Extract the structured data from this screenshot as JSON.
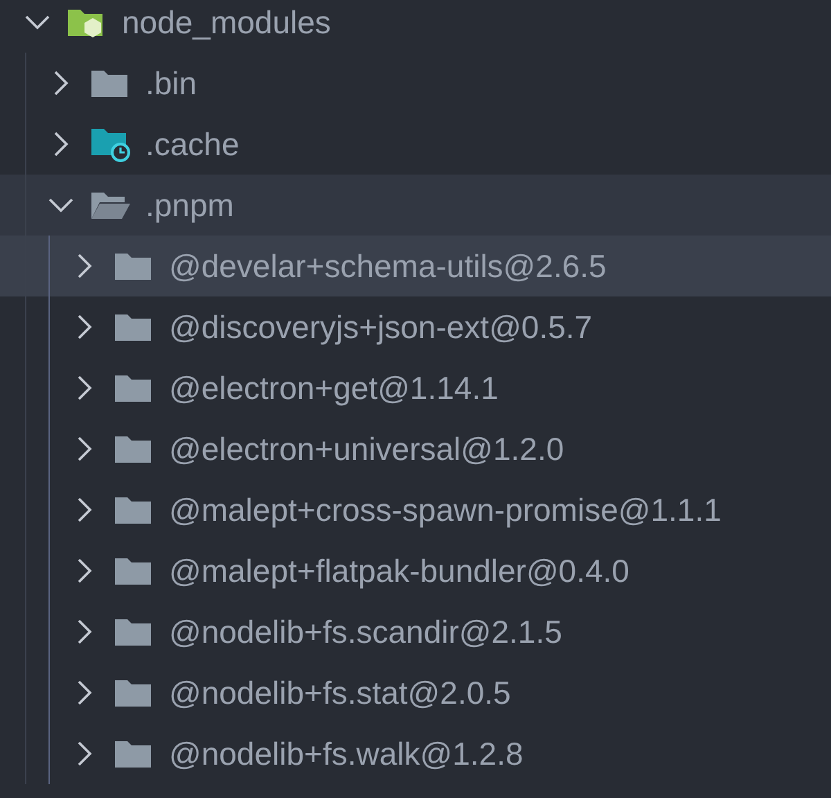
{
  "tree": [
    {
      "name": "node_modules",
      "kind": "node",
      "expanded": true,
      "selected": false,
      "hovered": false,
      "children": [
        {
          "name": ".bin",
          "kind": "folder",
          "expanded": false,
          "selected": false,
          "hovered": false
        },
        {
          "name": ".cache",
          "kind": "cache",
          "expanded": false,
          "selected": false,
          "hovered": false
        },
        {
          "name": ".pnpm",
          "kind": "folder",
          "expanded": true,
          "selected": false,
          "hovered": true,
          "children": [
            {
              "name": "@develar+schema-utils@2.6.5",
              "kind": "folder",
              "expanded": false,
              "selected": true,
              "hovered": false
            },
            {
              "name": "@discoveryjs+json-ext@0.5.7",
              "kind": "folder",
              "expanded": false,
              "selected": false,
              "hovered": false
            },
            {
              "name": "@electron+get@1.14.1",
              "kind": "folder",
              "expanded": false,
              "selected": false,
              "hovered": false
            },
            {
              "name": "@electron+universal@1.2.0",
              "kind": "folder",
              "expanded": false,
              "selected": false,
              "hovered": false
            },
            {
              "name": "@malept+cross-spawn-promise@1.1.1",
              "kind": "folder",
              "expanded": false,
              "selected": false,
              "hovered": false
            },
            {
              "name": "@malept+flatpak-bundler@0.4.0",
              "kind": "folder",
              "expanded": false,
              "selected": false,
              "hovered": false
            },
            {
              "name": "@nodelib+fs.scandir@2.1.5",
              "kind": "folder",
              "expanded": false,
              "selected": false,
              "hovered": false
            },
            {
              "name": "@nodelib+fs.stat@2.0.5",
              "kind": "folder",
              "expanded": false,
              "selected": false,
              "hovered": false
            },
            {
              "name": "@nodelib+fs.walk@1.2.8",
              "kind": "folder",
              "expanded": false,
              "selected": false,
              "hovered": false
            }
          ]
        }
      ]
    }
  ]
}
